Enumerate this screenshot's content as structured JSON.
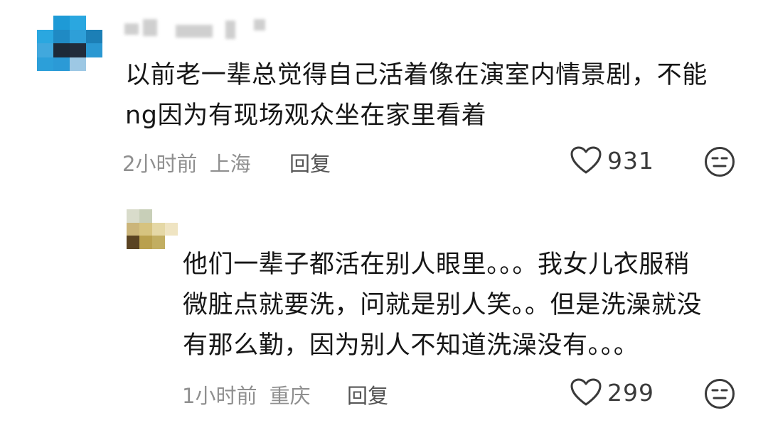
{
  "comments": [
    {
      "text": "以前老一辈总觉得自己活着像在演室内情景剧，不能\nng因为有现场观众坐在家里看着",
      "meta": {
        "time": "2小时前",
        "location": "上海"
      },
      "reply_label": "回复",
      "likes": "931",
      "icons": {
        "like": "heart-outline-icon",
        "dislike": "neutral-face-icon"
      }
    },
    {
      "text": "他们一辈子都活在别人眼里。。。我女儿衣服稍\n微脏点就要洗，问就是别人笑。。但是洗澡就没\n有那么勤，因为别人不知道洗澡没有。。。",
      "meta": {
        "time": "1小时前",
        "location": "重庆"
      },
      "reply_label": "回复",
      "likes": "299",
      "icons": {
        "like": "heart-outline-icon",
        "dislike": "neutral-face-icon"
      }
    }
  ],
  "colors": {
    "text": "#161616",
    "meta": "#8f8f8f",
    "reply": "#555555",
    "icon": "#3a3a3a"
  }
}
